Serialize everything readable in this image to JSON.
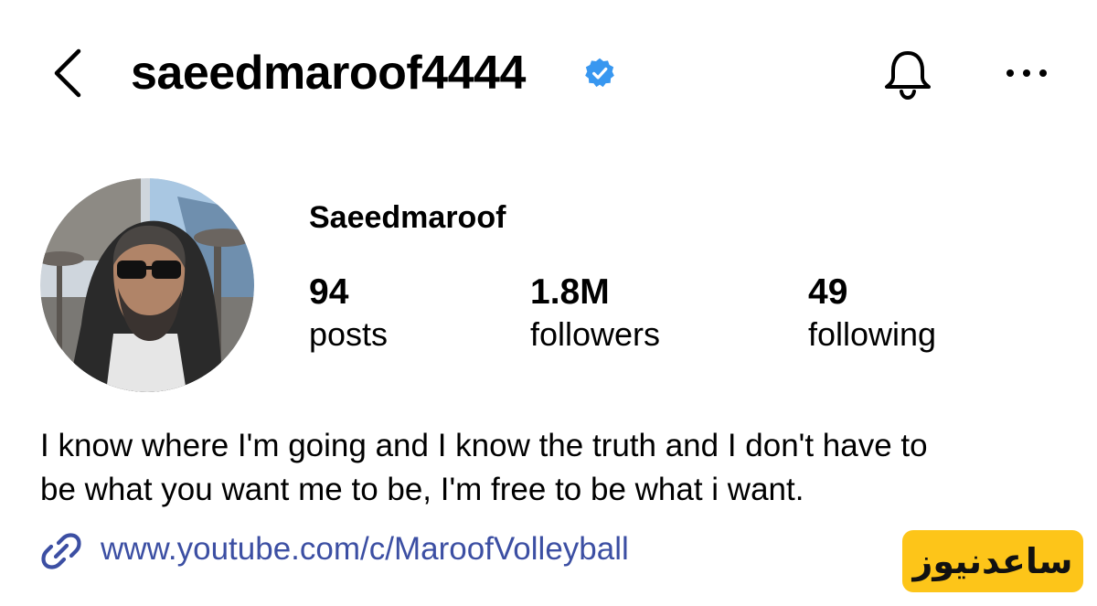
{
  "header": {
    "username": "saeedmaroof4444",
    "back_icon": "chevron-left-icon",
    "verified_icon": "verified-badge-icon",
    "notification_icon": "bell-icon",
    "more_icon": "more-horizontal-icon",
    "verified_color": "#3897f0"
  },
  "profile": {
    "display_name": "Saeedmaroof",
    "avatar": "profile-photo",
    "stats": {
      "posts_value": "94",
      "posts_label": "posts",
      "followers_value": "1.8M",
      "followers_label": "followers",
      "following_value": "49",
      "following_label": "following"
    },
    "bio_lines": [
      "I know where I'm going and I know the truth and I don't have to",
      "be what you want me to be, I'm free to be what i want."
    ],
    "link": {
      "icon": "link-icon",
      "text": "www.youtube.com/c/MaroofVolleyball"
    }
  },
  "watermark": {
    "text": "ساعدنیوز",
    "background": "#fdc519"
  },
  "colors": {
    "link": "#3c4fa3",
    "text": "#000000",
    "background": "#ffffff"
  }
}
